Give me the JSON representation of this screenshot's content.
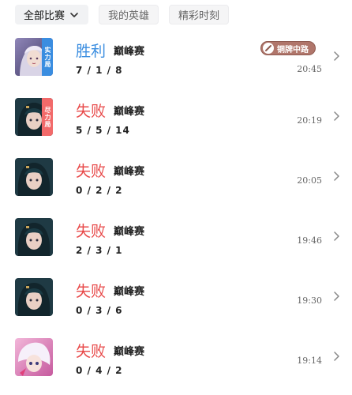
{
  "filters": [
    {
      "label": "全部比赛"
    },
    {
      "label": "我的英雄"
    },
    {
      "label": "精彩时刻"
    }
  ],
  "colors": {
    "win": "#3a8de0",
    "loss": "#e84a4a",
    "tag_blue": "#3a8de0",
    "tag_red": "#f26a6a",
    "medal_bg": "#b0766b"
  },
  "matches": [
    {
      "result": "胜利",
      "mode": "巅峰赛",
      "kda": "7 / 1 / 8",
      "time": "20:45",
      "tag": "实力局",
      "medal": "铜牌中路"
    },
    {
      "result": "失败",
      "mode": "巅峰赛",
      "kda": "5 / 5 / 14",
      "time": "20:19",
      "tag": "尽力局"
    },
    {
      "result": "失败",
      "mode": "巅峰赛",
      "kda": "0 / 2 / 2",
      "time": "20:05"
    },
    {
      "result": "失败",
      "mode": "巅峰赛",
      "kda": "2 / 3 / 1",
      "time": "19:46"
    },
    {
      "result": "失败",
      "mode": "巅峰赛",
      "kda": "0 / 3 / 6",
      "time": "19:30"
    },
    {
      "result": "失败",
      "mode": "巅峰赛",
      "kda": "0 / 4 / 2",
      "time": "19:14"
    }
  ]
}
